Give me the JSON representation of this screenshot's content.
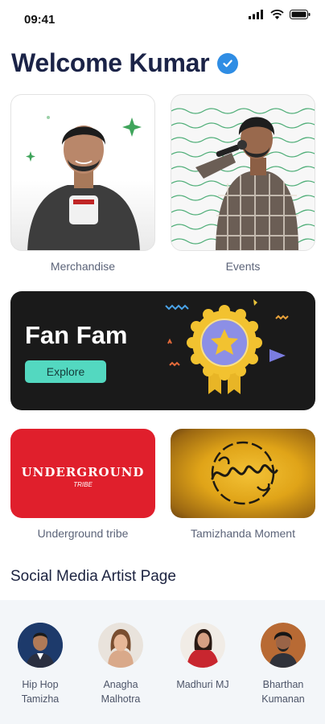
{
  "status_bar": {
    "time": "09:41"
  },
  "header": {
    "title": "Welcome Kumar"
  },
  "tiles": {
    "merchandise": {
      "label": "Merchandise",
      "badge_text": "TAMIZHA"
    },
    "events": {
      "label": "Events"
    }
  },
  "banner": {
    "title": "Fan Fam",
    "button": "Explore"
  },
  "communities": {
    "underground": {
      "label": "Underground tribe",
      "logo_text": "UNDERGROUND",
      "logo_sub": "TRIBE"
    },
    "tamizhanda": {
      "label": "Tamizhanda Moment"
    }
  },
  "artists_section": {
    "title": "Social Media Artist Page",
    "artists": [
      {
        "line1": "Hip Hop",
        "line2": "Tamizha"
      },
      {
        "line1": "Anagha",
        "line2": "Malhotra"
      },
      {
        "line1": "Madhuri MJ",
        "line2": ""
      },
      {
        "line1": "Bharthan",
        "line2": "Kumanan"
      }
    ]
  },
  "colors": {
    "title": "#1b2347",
    "verified": "#2f8de4",
    "banner_bg": "#1a1a1a",
    "explore": "#53d8c0",
    "underground_bg": "#e01f2c",
    "badge_gold": "#f2c230"
  }
}
